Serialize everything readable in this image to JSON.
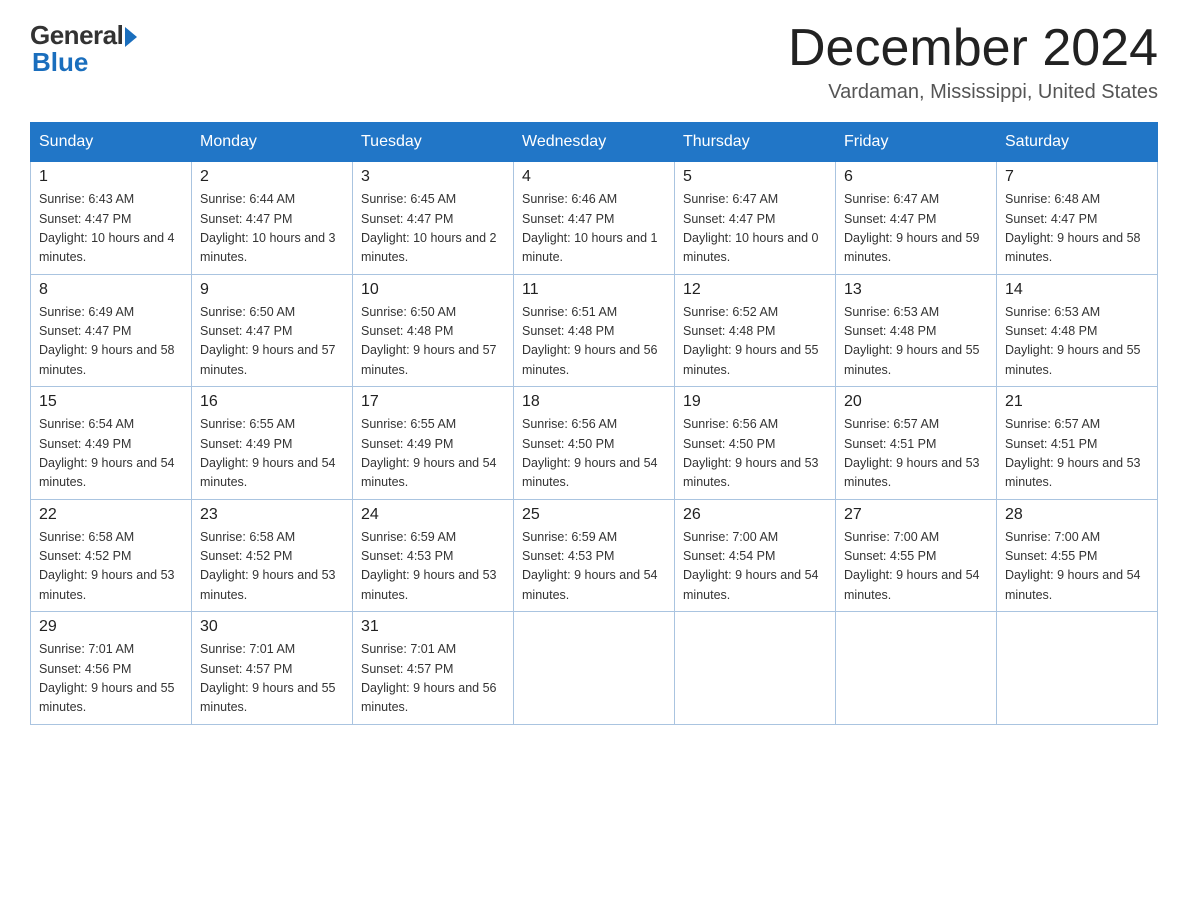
{
  "logo": {
    "general": "General",
    "blue": "Blue"
  },
  "header": {
    "month": "December 2024",
    "location": "Vardaman, Mississippi, United States"
  },
  "weekdays": [
    "Sunday",
    "Monday",
    "Tuesday",
    "Wednesday",
    "Thursday",
    "Friday",
    "Saturday"
  ],
  "weeks": [
    [
      {
        "day": "1",
        "sunrise": "6:43 AM",
        "sunset": "4:47 PM",
        "daylight": "10 hours and 4 minutes."
      },
      {
        "day": "2",
        "sunrise": "6:44 AM",
        "sunset": "4:47 PM",
        "daylight": "10 hours and 3 minutes."
      },
      {
        "day": "3",
        "sunrise": "6:45 AM",
        "sunset": "4:47 PM",
        "daylight": "10 hours and 2 minutes."
      },
      {
        "day": "4",
        "sunrise": "6:46 AM",
        "sunset": "4:47 PM",
        "daylight": "10 hours and 1 minute."
      },
      {
        "day": "5",
        "sunrise": "6:47 AM",
        "sunset": "4:47 PM",
        "daylight": "10 hours and 0 minutes."
      },
      {
        "day": "6",
        "sunrise": "6:47 AM",
        "sunset": "4:47 PM",
        "daylight": "9 hours and 59 minutes."
      },
      {
        "day": "7",
        "sunrise": "6:48 AM",
        "sunset": "4:47 PM",
        "daylight": "9 hours and 58 minutes."
      }
    ],
    [
      {
        "day": "8",
        "sunrise": "6:49 AM",
        "sunset": "4:47 PM",
        "daylight": "9 hours and 58 minutes."
      },
      {
        "day": "9",
        "sunrise": "6:50 AM",
        "sunset": "4:47 PM",
        "daylight": "9 hours and 57 minutes."
      },
      {
        "day": "10",
        "sunrise": "6:50 AM",
        "sunset": "4:48 PM",
        "daylight": "9 hours and 57 minutes."
      },
      {
        "day": "11",
        "sunrise": "6:51 AM",
        "sunset": "4:48 PM",
        "daylight": "9 hours and 56 minutes."
      },
      {
        "day": "12",
        "sunrise": "6:52 AM",
        "sunset": "4:48 PM",
        "daylight": "9 hours and 55 minutes."
      },
      {
        "day": "13",
        "sunrise": "6:53 AM",
        "sunset": "4:48 PM",
        "daylight": "9 hours and 55 minutes."
      },
      {
        "day": "14",
        "sunrise": "6:53 AM",
        "sunset": "4:48 PM",
        "daylight": "9 hours and 55 minutes."
      }
    ],
    [
      {
        "day": "15",
        "sunrise": "6:54 AM",
        "sunset": "4:49 PM",
        "daylight": "9 hours and 54 minutes."
      },
      {
        "day": "16",
        "sunrise": "6:55 AM",
        "sunset": "4:49 PM",
        "daylight": "9 hours and 54 minutes."
      },
      {
        "day": "17",
        "sunrise": "6:55 AM",
        "sunset": "4:49 PM",
        "daylight": "9 hours and 54 minutes."
      },
      {
        "day": "18",
        "sunrise": "6:56 AM",
        "sunset": "4:50 PM",
        "daylight": "9 hours and 54 minutes."
      },
      {
        "day": "19",
        "sunrise": "6:56 AM",
        "sunset": "4:50 PM",
        "daylight": "9 hours and 53 minutes."
      },
      {
        "day": "20",
        "sunrise": "6:57 AM",
        "sunset": "4:51 PM",
        "daylight": "9 hours and 53 minutes."
      },
      {
        "day": "21",
        "sunrise": "6:57 AM",
        "sunset": "4:51 PM",
        "daylight": "9 hours and 53 minutes."
      }
    ],
    [
      {
        "day": "22",
        "sunrise": "6:58 AM",
        "sunset": "4:52 PM",
        "daylight": "9 hours and 53 minutes."
      },
      {
        "day": "23",
        "sunrise": "6:58 AM",
        "sunset": "4:52 PM",
        "daylight": "9 hours and 53 minutes."
      },
      {
        "day": "24",
        "sunrise": "6:59 AM",
        "sunset": "4:53 PM",
        "daylight": "9 hours and 53 minutes."
      },
      {
        "day": "25",
        "sunrise": "6:59 AM",
        "sunset": "4:53 PM",
        "daylight": "9 hours and 54 minutes."
      },
      {
        "day": "26",
        "sunrise": "7:00 AM",
        "sunset": "4:54 PM",
        "daylight": "9 hours and 54 minutes."
      },
      {
        "day": "27",
        "sunrise": "7:00 AM",
        "sunset": "4:55 PM",
        "daylight": "9 hours and 54 minutes."
      },
      {
        "day": "28",
        "sunrise": "7:00 AM",
        "sunset": "4:55 PM",
        "daylight": "9 hours and 54 minutes."
      }
    ],
    [
      {
        "day": "29",
        "sunrise": "7:01 AM",
        "sunset": "4:56 PM",
        "daylight": "9 hours and 55 minutes."
      },
      {
        "day": "30",
        "sunrise": "7:01 AM",
        "sunset": "4:57 PM",
        "daylight": "9 hours and 55 minutes."
      },
      {
        "day": "31",
        "sunrise": "7:01 AM",
        "sunset": "4:57 PM",
        "daylight": "9 hours and 56 minutes."
      },
      null,
      null,
      null,
      null
    ]
  ]
}
